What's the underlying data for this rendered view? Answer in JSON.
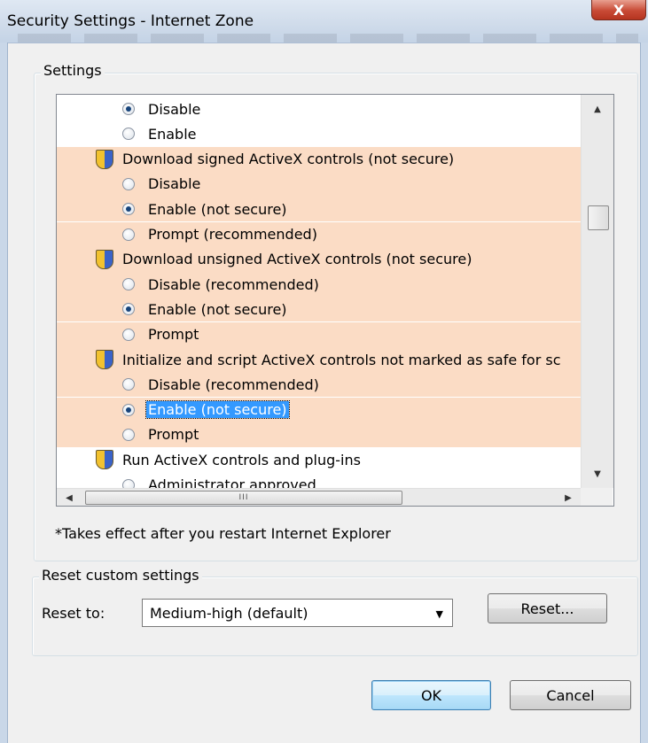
{
  "window": {
    "title": "Security Settings - Internet Zone",
    "close_label": "X"
  },
  "settings_group": {
    "legend": "Settings",
    "items": [
      {
        "kind": "option",
        "label": "Disable",
        "selected": true,
        "highlight": false
      },
      {
        "kind": "option",
        "label": "Enable",
        "selected": false,
        "highlight": false
      },
      {
        "kind": "category",
        "label": "Download signed ActiveX controls (not secure)",
        "highlight": true
      },
      {
        "kind": "option",
        "label": "Disable",
        "selected": false,
        "highlight": true
      },
      {
        "kind": "option",
        "label": "Enable (not secure)",
        "selected": true,
        "highlight": true
      },
      {
        "kind": "option",
        "label": "Prompt (recommended)",
        "selected": false,
        "highlight": true
      },
      {
        "kind": "category",
        "label": "Download unsigned ActiveX controls (not secure)",
        "highlight": true
      },
      {
        "kind": "option",
        "label": "Disable (recommended)",
        "selected": false,
        "highlight": true
      },
      {
        "kind": "option",
        "label": "Enable (not secure)",
        "selected": true,
        "highlight": true
      },
      {
        "kind": "option",
        "label": "Prompt",
        "selected": false,
        "highlight": true
      },
      {
        "kind": "category",
        "label": "Initialize and script ActiveX controls not marked as safe for sc",
        "highlight": true
      },
      {
        "kind": "option",
        "label": "Disable (recommended)",
        "selected": false,
        "highlight": true
      },
      {
        "kind": "option",
        "label": "Enable (not secure)",
        "selected": true,
        "highlight": true,
        "focused": true
      },
      {
        "kind": "option",
        "label": "Prompt",
        "selected": false,
        "highlight": true
      },
      {
        "kind": "category",
        "label": "Run ActiveX controls and plug-ins",
        "highlight": false
      },
      {
        "kind": "option",
        "label": "Administrator approved",
        "selected": false,
        "highlight": false
      }
    ],
    "hscroll_grip": "III"
  },
  "note": "*Takes effect after you restart Internet Explorer",
  "reset_group": {
    "legend": "Reset custom settings",
    "reset_to_label": "Reset to:",
    "dropdown_value": "Medium-high (default)",
    "reset_button": "Reset..."
  },
  "buttons": {
    "ok": "OK",
    "cancel": "Cancel"
  },
  "colors": {
    "highlight_row": "#fbdcc5",
    "selection": "#3399ff"
  }
}
